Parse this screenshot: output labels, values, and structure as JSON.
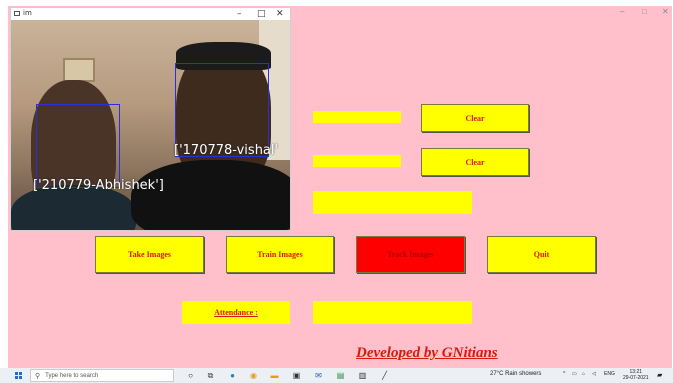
{
  "camera_window": {
    "title": "im",
    "controls": {
      "minimize": "–",
      "maximize": "□",
      "close": "✕"
    },
    "faces": [
      {
        "label": "['210779-Abhishek']"
      },
      {
        "label": "['170778-vishal'"
      }
    ]
  },
  "main_window": {
    "controls": {
      "minimize": "–",
      "maximize": "□",
      "close": "✕"
    },
    "fields": {
      "id_value": "",
      "name_value": "",
      "notification_value": "",
      "attendance_value": ""
    },
    "buttons": {
      "clear_1": "Clear",
      "clear_2": "Clear",
      "take_images": "Take Images",
      "train_images": "Train Images",
      "track_images": "Track Images",
      "quit": "Quit"
    },
    "attendance_label": "Attendance :",
    "footer": "Developed by GNitians"
  },
  "taskbar": {
    "search_placeholder": "Type here to search",
    "weather": "27°C  Rain showers",
    "language": "ENG",
    "time": "13:21",
    "date": "29-07-2021",
    "icons": [
      "task-view-icon",
      "edge-icon",
      "chrome-icon",
      "file-explorer-icon",
      "store-icon",
      "mail-icon",
      "terminal-icon",
      "app-icon",
      "pen-icon"
    ]
  },
  "colors": {
    "background": "#ffc0cb",
    "field": "#ffff00",
    "button_text": "#d8190f",
    "track_button": "#ff0000",
    "face_box": "#2a2fd6"
  }
}
